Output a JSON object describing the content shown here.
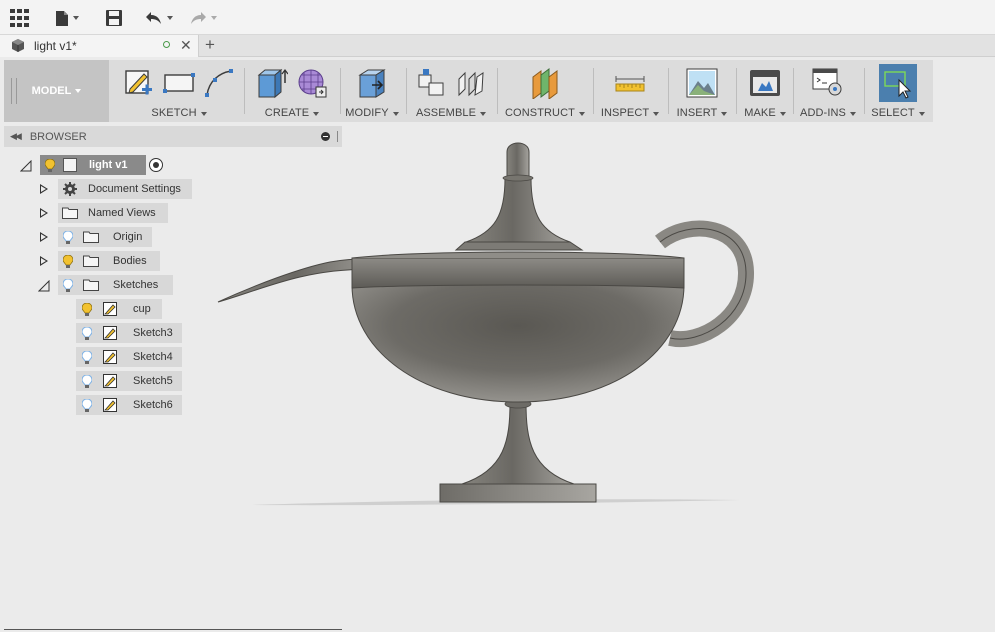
{
  "document": {
    "tab_title": "light v1*"
  },
  "toolbar": {
    "workspace": "MODEL",
    "groups": [
      {
        "label": "SKETCH"
      },
      {
        "label": "CREATE"
      },
      {
        "label": "MODIFY"
      },
      {
        "label": "ASSEMBLE"
      },
      {
        "label": "CONSTRUCT"
      },
      {
        "label": "INSPECT"
      },
      {
        "label": "INSERT"
      },
      {
        "label": "MAKE"
      },
      {
        "label": "ADD-INS"
      },
      {
        "label": "SELECT"
      }
    ]
  },
  "browser": {
    "title": "BROWSER",
    "root": "light v1",
    "items": [
      {
        "label": "Document Settings",
        "icon": "gear-icon"
      },
      {
        "label": "Named Views",
        "icon": "folder-icon"
      },
      {
        "label": "Origin",
        "icon": "folder-icon"
      },
      {
        "label": "Bodies",
        "icon": "folder-icon"
      },
      {
        "label": "Sketches",
        "icon": "folder-icon"
      }
    ],
    "sketches": [
      {
        "label": "cup"
      },
      {
        "label": "Sketch3"
      },
      {
        "label": "Sketch4"
      },
      {
        "label": "Sketch5"
      },
      {
        "label": "Sketch6"
      }
    ]
  },
  "colors": {
    "accent_select": "#4b7fae",
    "bulb_on": "#f2c230",
    "bulb_off": "#7fb2e5",
    "model_body": "#6b6963"
  }
}
